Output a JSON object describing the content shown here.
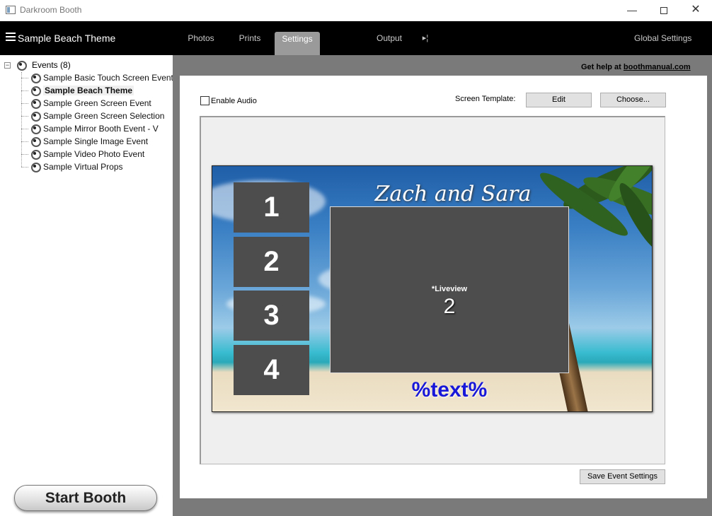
{
  "window": {
    "title": "Darkroom Booth",
    "minimize": "—",
    "close": "✕"
  },
  "menubar": {
    "event_title": "Sample Beach Theme",
    "tabs": [
      "Photos",
      "Prints",
      "Settings",
      "Output"
    ],
    "active_tab": "Settings",
    "more_glyph": "▸¦",
    "global_settings": "Global Settings"
  },
  "sidebar": {
    "root": {
      "expander": "−",
      "label": "Events (8)"
    },
    "items": [
      {
        "label": "Sample Basic Touch Screen Event",
        "selected": false
      },
      {
        "label": "Sample Beach Theme",
        "selected": true
      },
      {
        "label": "Sample Green Screen Event",
        "selected": false
      },
      {
        "label": "Sample Green Screen Selection",
        "selected": false
      },
      {
        "label": "Sample Mirror Booth Event - V",
        "selected": false
      },
      {
        "label": "Sample Single Image Event",
        "selected": false
      },
      {
        "label": "Sample Video Photo Event",
        "selected": false
      },
      {
        "label": "Sample Virtual Props",
        "selected": false
      }
    ],
    "start_button": "Start Booth"
  },
  "settings": {
    "help_prefix": "Get help at",
    "help_link": "boothmanual.com",
    "enable_audio_label": "Enable Audio",
    "enable_audio_checked": false,
    "screen_template_label": "Screen Template:",
    "edit_button": "Edit",
    "choose_button": "Choose...",
    "save_button": "Save Event Settings"
  },
  "template_preview": {
    "heading": "Zach and Sara",
    "slots": [
      "1",
      "2",
      "3",
      "4"
    ],
    "liveview_label": "*Liveview",
    "liveview_count": "2",
    "text_placeholder": "%text%"
  },
  "colors": {
    "menubar_bg": "#000000",
    "frame_gray": "#7a7a7a",
    "slot_gray": "#4d4d4d",
    "text_token_blue": "#1818d8"
  }
}
